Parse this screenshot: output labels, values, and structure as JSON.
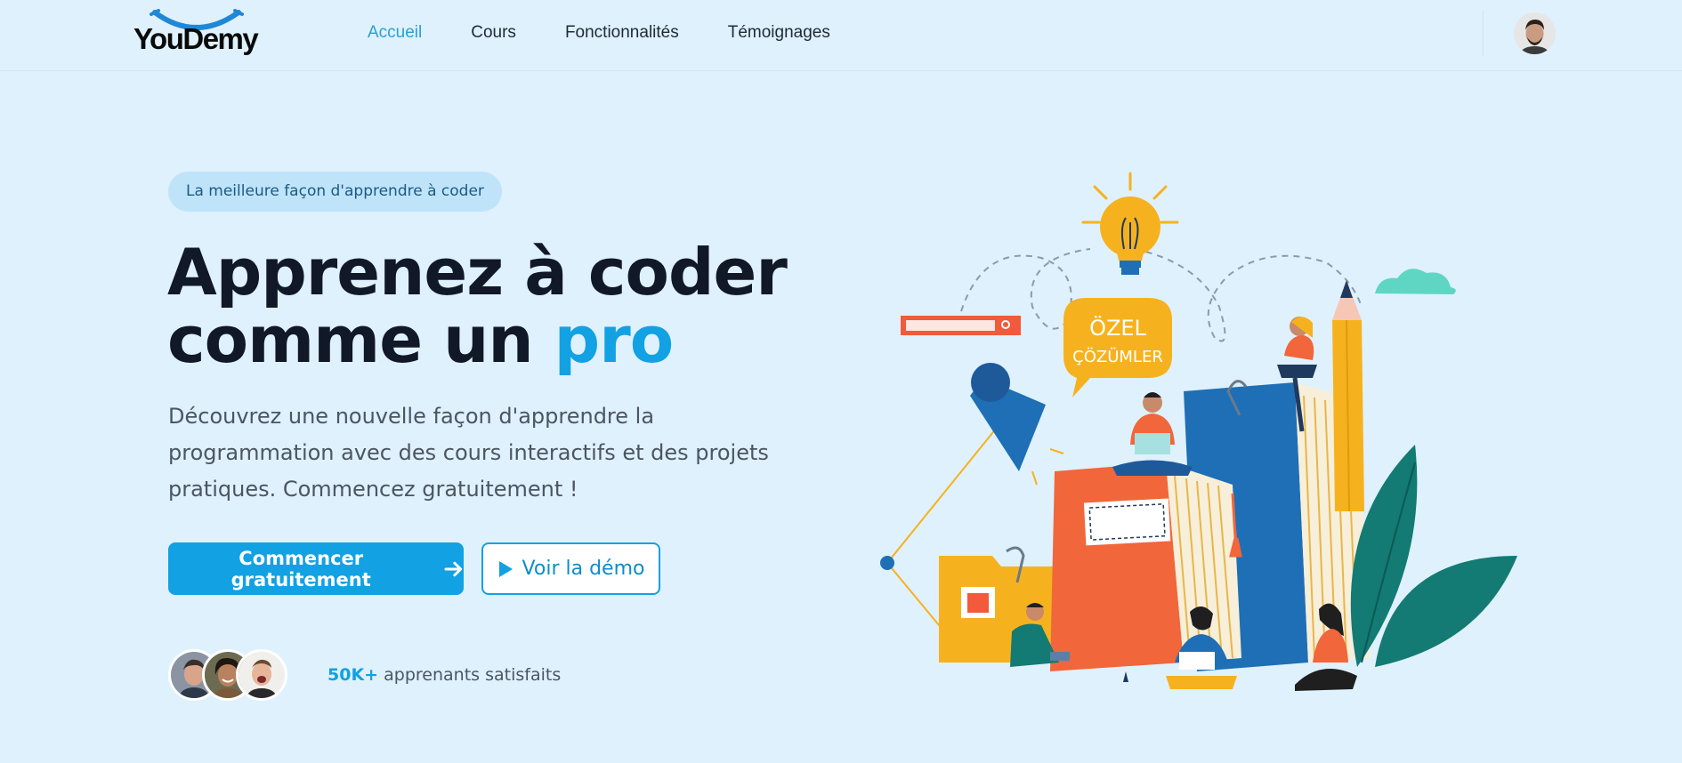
{
  "brand": {
    "name": "YouDemy"
  },
  "nav": {
    "items": [
      {
        "label": "Accueil",
        "active": true
      },
      {
        "label": "Cours",
        "active": false
      },
      {
        "label": "Fonctionnalités",
        "active": false
      },
      {
        "label": "Témoignages",
        "active": false
      }
    ]
  },
  "hero": {
    "badge": "La meilleure façon d'apprendre à coder",
    "title_line1": "Apprenez à coder",
    "title_line2": "comme un ",
    "title_accent": "pro",
    "description": "Découvrez une nouvelle façon d'apprendre la programmation avec des cours interactifs et des projets pratiques. Commencez gratuitement !",
    "primary_cta": "Commencer gratuitement",
    "secondary_cta": "Voir la démo",
    "social_proof_count": "50K+",
    "social_proof_text": "apprenants satisfaits"
  },
  "illustration": {
    "bubble_line1": "ÖZEL",
    "bubble_line2": "ÇÖZÜMLER"
  },
  "colors": {
    "background": "#dff1fc",
    "accent": "#12a1e3",
    "heading": "#111827",
    "badge_bg": "#bfe4fa"
  }
}
